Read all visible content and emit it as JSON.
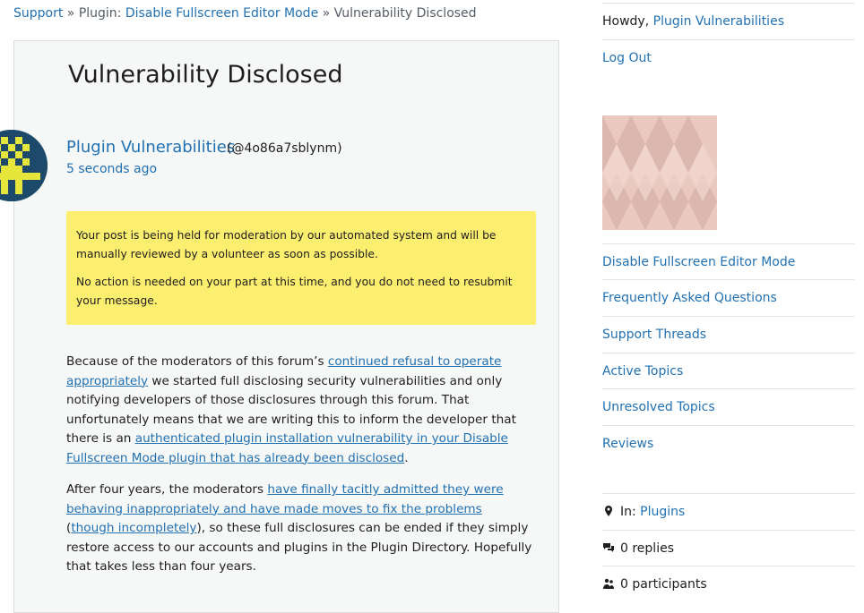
{
  "breadcrumb": {
    "support": "Support",
    "sep1": " » ",
    "plugin_prefix": "Plugin: ",
    "plugin_link": "Disable Fullscreen Editor Mode",
    "sep2": " » ",
    "current": "Vulnerability Disclosed"
  },
  "topic": {
    "title": "Vulnerability Disclosed",
    "author_name": "Plugin Vulnerabilities",
    "author_handle": "(@4o86a7sblynm)",
    "posted_ago": "5 seconds ago"
  },
  "notice": {
    "line1": "Your post is being held for moderation by our automated system and will be manually reviewed by a volunteer as soon as possible.",
    "line2": "No action is needed on your part at this time, and you do not need to resubmit your message."
  },
  "body": {
    "p1_a": "Because of the moderators of this forum’s ",
    "p1_link1": "continued refusal to operate appropriately",
    "p1_b": " we started full disclosing security vulnerabilities and only notifying developers of those disclosures through this forum. That unfortunately means that we are writing this to inform the developer that there is an ",
    "p1_link2": "authenticated plugin installation vulnerability in your Disable Fullscreen Mode plugin that has already been disclosed",
    "p1_c": ".",
    "p2_a": "After four years, the moderators ",
    "p2_link1": "have finally tacitly admitted they were behaving inappropriately and have made moves to fix the problems",
    "p2_b": " (",
    "p2_link2": "though incompletely",
    "p2_c": "), so these full disclosures can be ended if they simply restore access to our accounts and plugins in the Plugin Directory. Hopefully that takes less than four years."
  },
  "sidebar": {
    "howdy": "Howdy, ",
    "user_link": "Plugin Vulnerabilities",
    "logout": "Log Out",
    "links": [
      "Disable Fullscreen Editor Mode",
      "Frequently Asked Questions",
      "Support Threads",
      "Active Topics",
      "Unresolved Topics",
      "Reviews"
    ],
    "meta": {
      "in_label": "In: ",
      "in_link": "Plugins",
      "replies": "0 replies",
      "participants": "0 participants"
    }
  },
  "colors": {
    "link": "#2271b1",
    "notice_bg": "#fcee6f",
    "card_bg": "#f6f7f7",
    "avatar_dark": "#1d4a6a",
    "avatar_light": "#e6e63a",
    "cover_bg": "#e9c9c0"
  },
  "icons": {
    "in": "location-pin-icon",
    "replies": "speech-bubbles-icon",
    "participants": "people-icon"
  }
}
